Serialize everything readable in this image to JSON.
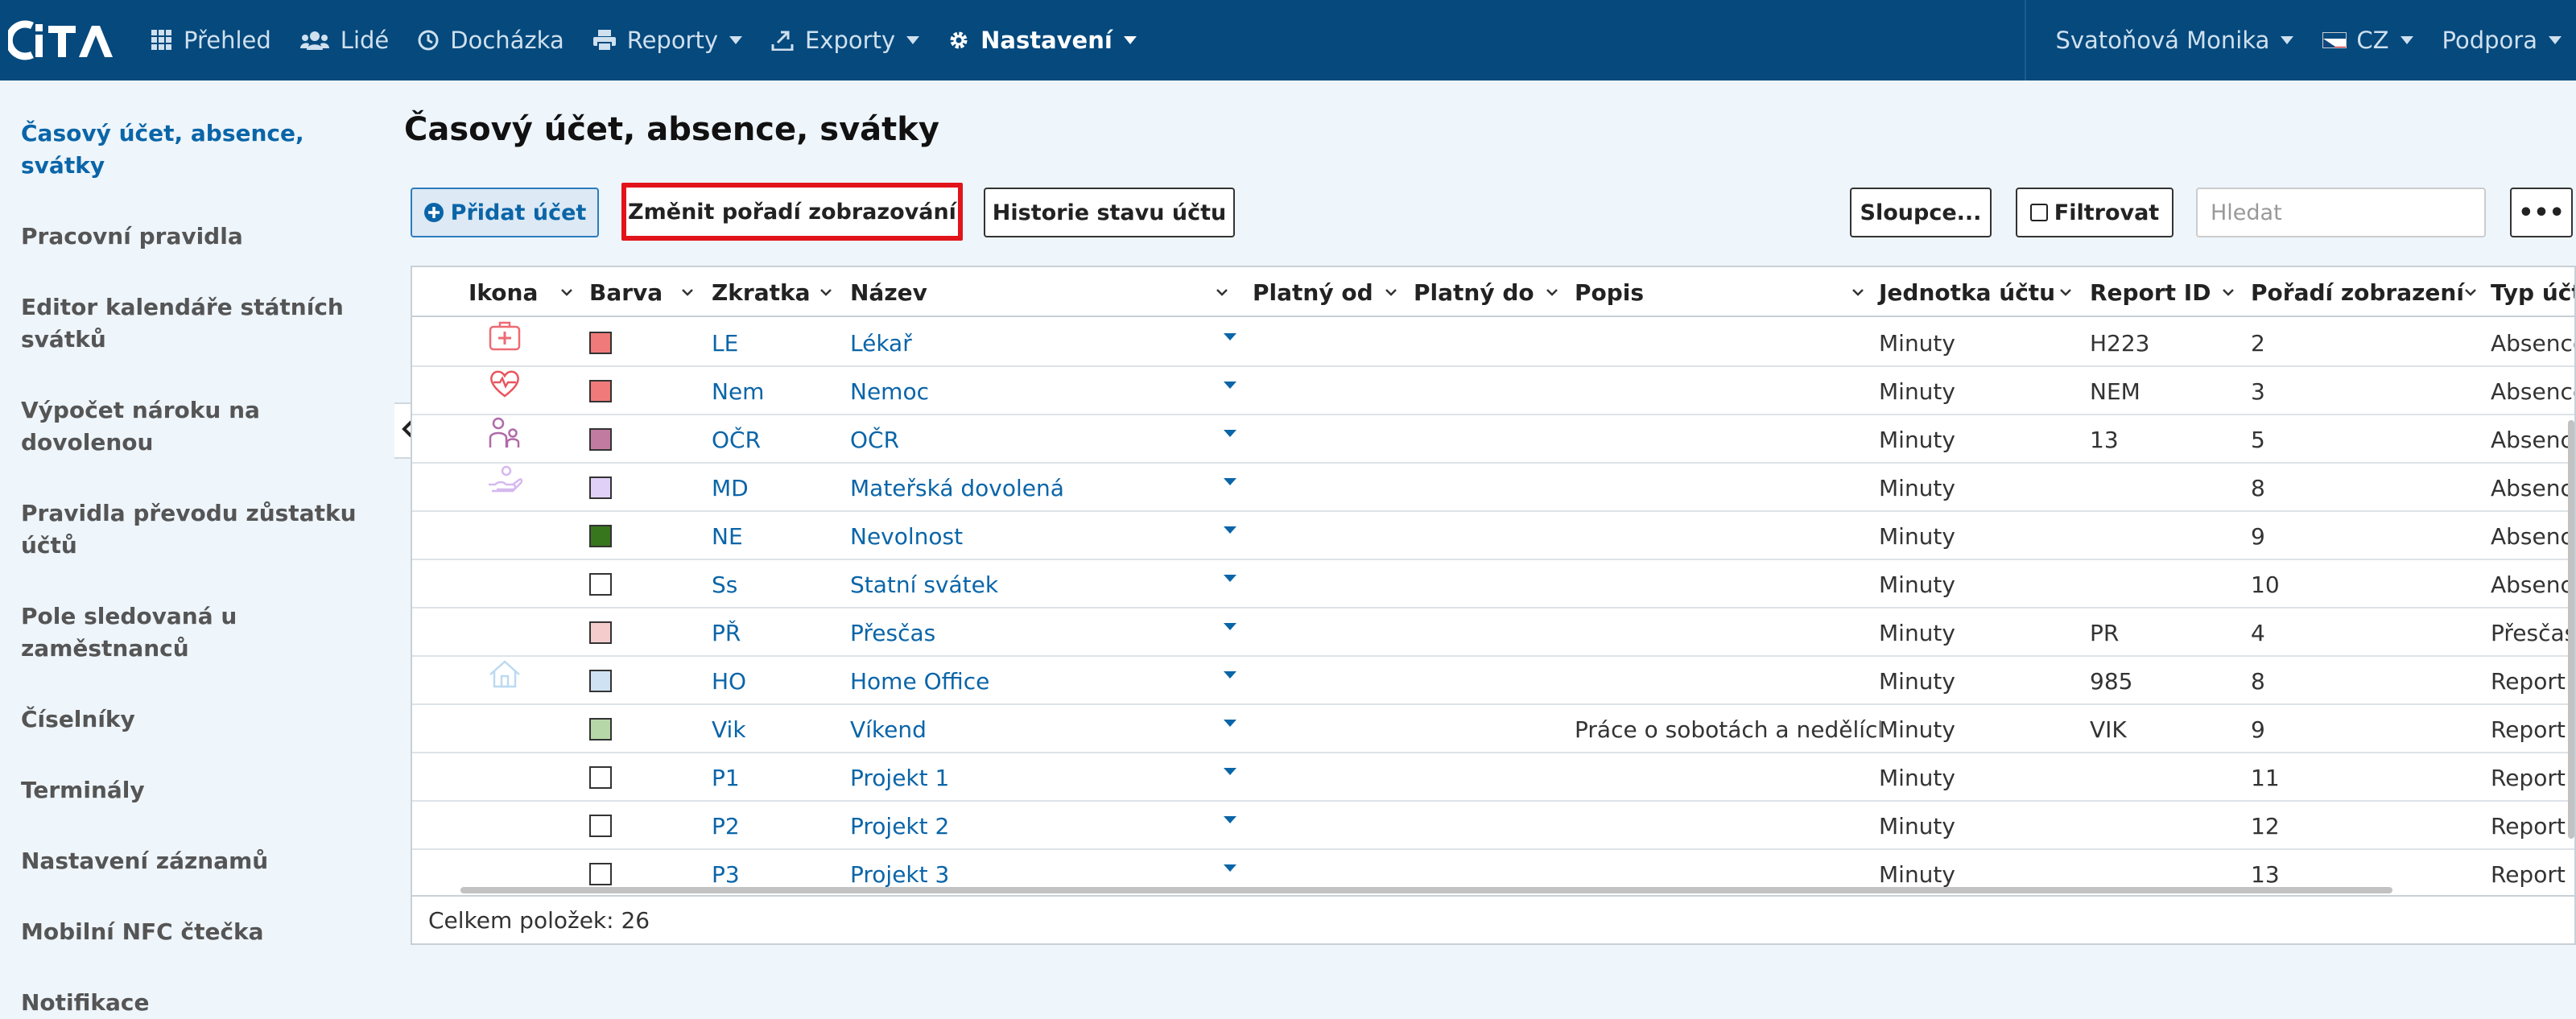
{
  "brand": {
    "logo_text": "ITA"
  },
  "nav": {
    "overview": "Přehled",
    "people": "Lidé",
    "attendance": "Docházka",
    "reports": "Reporty",
    "exports": "Exporty",
    "settings": "Nastavení",
    "user": "Svatoňová Monika",
    "language": "CZ",
    "support": "Podpora"
  },
  "sidebar": {
    "items": [
      {
        "label": "Časový účet, absence, svátky"
      },
      {
        "label": "Pracovní pravidla"
      },
      {
        "label": "Editor kalendáře státních svátků"
      },
      {
        "label": "Výpočet nároku na dovolenou"
      },
      {
        "label": "Pravidla převodu zůstatku účtů"
      },
      {
        "label": "Pole sledovaná u zaměstnanců"
      },
      {
        "label": "Číselníky"
      },
      {
        "label": "Terminály"
      },
      {
        "label": "Nastavení záznamů"
      },
      {
        "label": "Mobilní NFC čtečka"
      },
      {
        "label": "Notifikace"
      }
    ]
  },
  "page": {
    "title": "Časový účet, absence, svátky"
  },
  "toolbar": {
    "add": "Přidat účet",
    "change_order": "Změnit pořadí zobrazování",
    "history": "Historie stavu účtu",
    "columns": "Sloupce...",
    "filter": "Filtrovat",
    "search_placeholder": "Hledat",
    "more": "•••"
  },
  "table": {
    "columns": {
      "icon": "Ikona",
      "color": "Barva",
      "abbr": "Zkratka",
      "name": "Název",
      "valid_from": "Platný od",
      "valid_to": "Platný do",
      "description": "Popis",
      "unit": "Jednotka účtu",
      "report_id": "Report ID",
      "order": "Pořadí zobrazení",
      "type": "Typ účtu"
    },
    "rows": [
      {
        "icon": "medical-kit-icon",
        "color": "#f07a7a",
        "abbr": "LE",
        "name": "Lékař",
        "desc": "",
        "unit": "Minuty",
        "report_id": "H223",
        "order": "2",
        "type": "Absence"
      },
      {
        "icon": "heartbeat-icon",
        "color": "#f07a7a",
        "abbr": "Nem",
        "name": "Nemoc",
        "desc": "",
        "unit": "Minuty",
        "report_id": "NEM",
        "order": "3",
        "type": "Absence"
      },
      {
        "icon": "parent-child-icon",
        "color": "#c27ba0",
        "abbr": "OČR",
        "name": "OČR",
        "desc": "",
        "unit": "Minuty",
        "report_id": "13",
        "order": "5",
        "type": "Absence"
      },
      {
        "icon": "hand-care-icon",
        "color": "#e0d0f8",
        "abbr": "MD",
        "name": "Mateřská dovolená",
        "desc": "",
        "unit": "Minuty",
        "report_id": "",
        "order": "8",
        "type": "Absence"
      },
      {
        "icon": "",
        "color": "#38761d",
        "abbr": "NE",
        "name": "Nevolnost",
        "desc": "",
        "unit": "Minuty",
        "report_id": "",
        "order": "9",
        "type": "Absence"
      },
      {
        "icon": "",
        "color": "#ffffff",
        "abbr": "Ss",
        "name": "Statní svátek",
        "desc": "",
        "unit": "Minuty",
        "report_id": "",
        "order": "10",
        "type": "Absence"
      },
      {
        "icon": "",
        "color": "#f4cccc",
        "abbr": "PŘ",
        "name": "Přesčas",
        "desc": "",
        "unit": "Minuty",
        "report_id": "PR",
        "order": "4",
        "type": "Přesčas"
      },
      {
        "icon": "home-icon",
        "color": "#cfe2f3",
        "abbr": "HO",
        "name": "Home Office",
        "desc": "",
        "unit": "Minuty",
        "report_id": "985",
        "order": "8",
        "type": "Report"
      },
      {
        "icon": "",
        "color": "#b6d7a8",
        "abbr": "Vik",
        "name": "Víkend",
        "desc": "Práce o sobotách a nedělích",
        "unit": "Minuty",
        "report_id": "VIK",
        "order": "9",
        "type": "Report"
      },
      {
        "icon": "",
        "color": "#ffffff",
        "abbr": "P1",
        "name": "Projekt 1",
        "desc": "",
        "unit": "Minuty",
        "report_id": "",
        "order": "11",
        "type": "Report"
      },
      {
        "icon": "",
        "color": "#ffffff",
        "abbr": "P2",
        "name": "Projekt 2",
        "desc": "",
        "unit": "Minuty",
        "report_id": "",
        "order": "12",
        "type": "Report"
      },
      {
        "icon": "",
        "color": "#ffffff",
        "abbr": "P3",
        "name": "Projekt 3",
        "desc": "",
        "unit": "Minuty",
        "report_id": "",
        "order": "13",
        "type": "Report"
      }
    ],
    "footer": "Celkem položek: 26"
  }
}
